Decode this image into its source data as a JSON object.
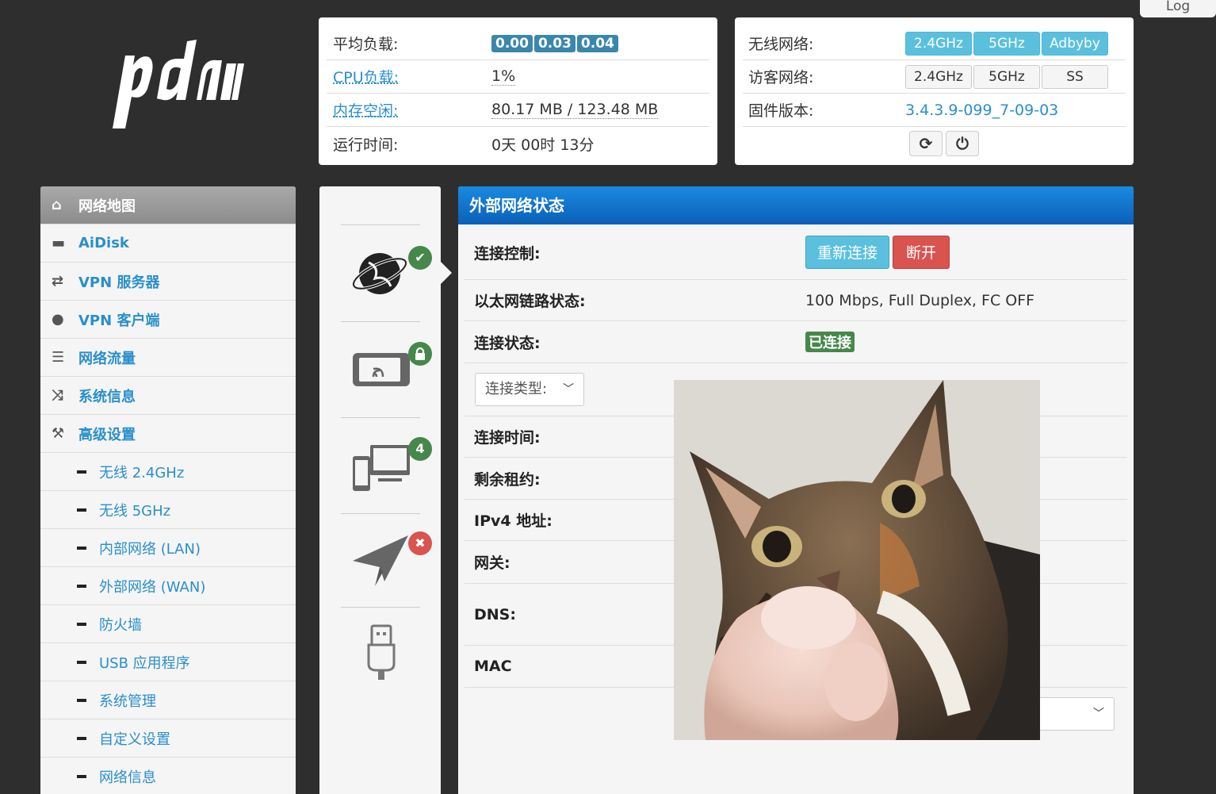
{
  "logo_text": "padavan",
  "logout_label": "Log",
  "system": {
    "load_label": "平均负载:",
    "load_values": [
      "0.00",
      "0.03",
      "0.04"
    ],
    "cpu_label": "CPU负载:",
    "cpu_value": "1%",
    "mem_label": "内存空闲:",
    "mem_value": "80.17 MB / 123.48 MB",
    "uptime_label": "运行时间:",
    "uptime_value": "0天 00时 13分"
  },
  "wireless": {
    "wifi_label": "无线网络:",
    "wifi_buttons": [
      "2.4GHz",
      "5GHz",
      "Adbyby"
    ],
    "guest_label": "访客网络:",
    "guest_buttons": [
      "2.4GHz",
      "5GHz",
      "SS"
    ],
    "firmware_label": "固件版本:",
    "firmware_value": "3.4.3.9-099_7-09-03",
    "refresh_icon": "refresh-icon",
    "power_icon": "power-icon"
  },
  "menu": {
    "items": [
      {
        "label": "网络地图",
        "icon": "home-icon"
      },
      {
        "label": "AiDisk",
        "icon": "hdd-icon"
      },
      {
        "label": "VPN 服务器",
        "icon": "retweet-icon"
      },
      {
        "label": "VPN 客户端",
        "icon": "globe-icon"
      },
      {
        "label": "网络流量",
        "icon": "tasks-icon"
      },
      {
        "label": "系统信息",
        "icon": "random-icon"
      },
      {
        "label": "高级设置",
        "icon": "wrench-icon"
      }
    ],
    "sub_items": [
      "无线 2.4GHz",
      "无线 5GHz",
      "内部网络 (LAN)",
      "外部网络 (WAN)",
      "防火墙",
      "USB 应用程序",
      "系统管理",
      "自定义设置",
      "网络信息"
    ]
  },
  "status_badges": {
    "clients_count": "4"
  },
  "main": {
    "title": "外部网络状态",
    "control_label": "连接控制:",
    "reconnect_label": "重新连接",
    "disconnect_label": "断开",
    "ethernet_label": "以太网链路状态:",
    "ethernet_value": "100 Mbps, Full Duplex, FC OFF",
    "status_label": "连接状态:",
    "status_value": "已连接",
    "conn_type_placeholder": "连接类型:",
    "conn_time_label": "连接时间:",
    "lease_label": "剩余租约:",
    "ipv4_label": "IPv4 地址:",
    "gateway_label": "网关:",
    "dns_label": "DNS:",
    "mac_label": "MAC"
  },
  "colors": {
    "accent": "#2a8fcb",
    "header_blue": "#0b6fcf",
    "success": "#46884a",
    "danger": "#d9534f",
    "info": "#5bc0de"
  }
}
